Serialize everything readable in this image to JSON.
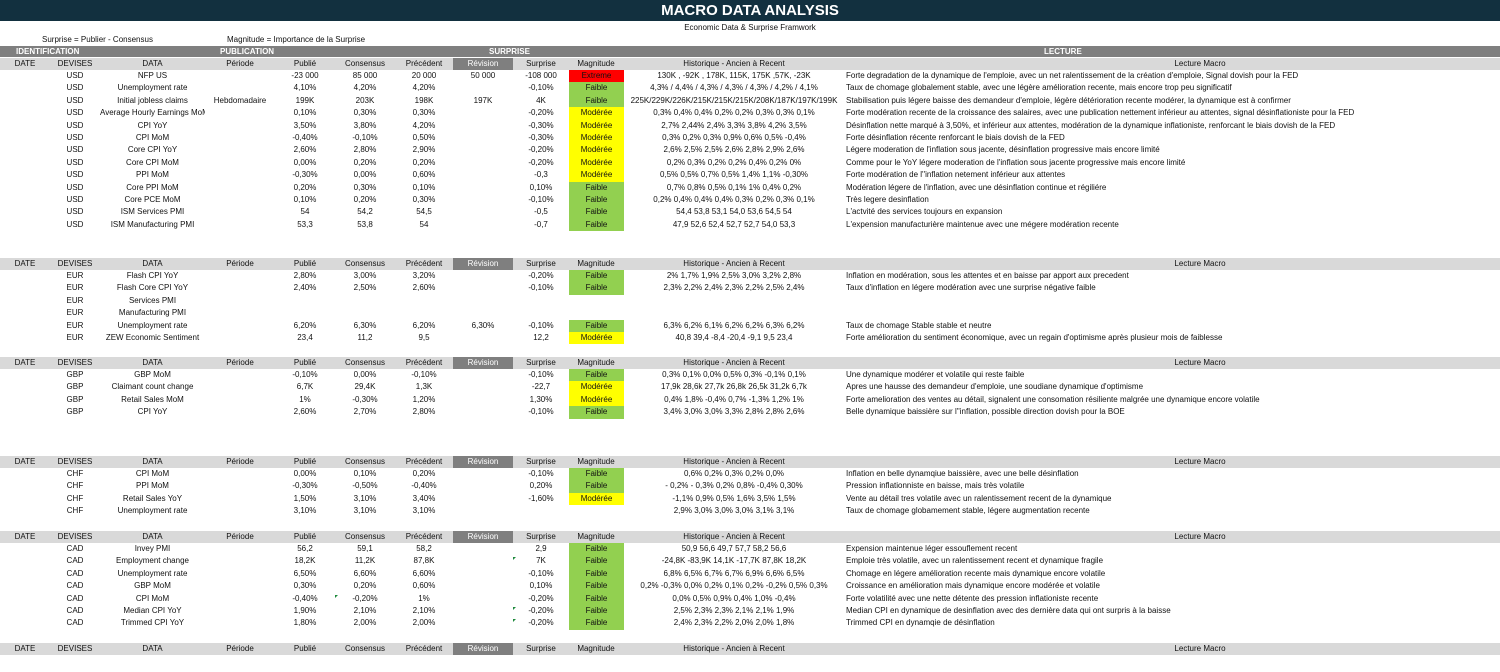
{
  "title": "MACRO DATA ANALYSIS",
  "subtitle": "Economic Data & Surprise Framwork",
  "legend": {
    "surprise": "Surprise = Publier - Consensus",
    "magnitude": "Magnitude = Importance de la Surprise"
  },
  "groups": {
    "identification": "IDENTIFICATION",
    "publication": "PUBLICATION",
    "surprise": "SURPRISE",
    "lecture": "LECTURE"
  },
  "headers": {
    "date": "DATE",
    "devises": "DEVISES",
    "data": "DATA",
    "periode": "Période",
    "publie": "Publié",
    "consensus": "Consensus",
    "precedent": "Précédent",
    "revision": "Révision",
    "surprise": "Surprise",
    "magnitude": "Magnitude",
    "historique": "Historique - Ancien à Recent",
    "lecture": "Lecture Macro"
  },
  "colors": {
    "title_bg": "#12303f",
    "faible": "#92d050",
    "moderee": "#ffff00",
    "extreme": "#ff0000"
  },
  "sections": [
    {
      "rows": [
        {
          "devise": "USD",
          "data": "NFP US",
          "periode": "",
          "publie": "-23 000",
          "consensus": "85 000",
          "precedent": "20 000",
          "revision": "50 000",
          "surprise": "-108 000",
          "magnitude": "Extreme",
          "historique": "130K , -92K , 178K, 115K, 175K ,57K, -23K",
          "lecture": "Forte degradation de la dynamique de l'emploie, avec un net ralentissement de la création d'emploie, Signal dovish pour la FED"
        },
        {
          "devise": "USD",
          "data": "Unemployment rate",
          "periode": "",
          "publie": "4,10%",
          "consensus": "4,20%",
          "precedent": "4,20%",
          "revision": "",
          "surprise": "-0,10%",
          "magnitude": "Faible",
          "historique": "4,3% / 4,4% / 4,3% / 4,3% / 4,3% / 4,2% / 4,1%",
          "lecture": "Taux de chomage globalement stable, avec une légère amélioration recente, mais encore trop peu significatif"
        },
        {
          "devise": "USD",
          "data": "Initial jobless claims",
          "periode": "Hebdomadaire",
          "publie": "199K",
          "consensus": "203K",
          "precedent": "198K",
          "revision": "197K",
          "surprise": "4K",
          "magnitude": "Faible",
          "historique": "225K/229K/226K/215K/215K/215K/208K/187K/197K/199K",
          "lecture": "Stabilisation puis légere baisse des demandeur d'emploie, légère détérioration recente modérer, la dynamique est à confirmer"
        },
        {
          "devise": "USD",
          "data": "Average Hourly Earnings MoM",
          "periode": "",
          "publie": "0,10%",
          "consensus": "0,30%",
          "precedent": "0,30%",
          "revision": "",
          "surprise": "-0,20%",
          "magnitude": "Modérée",
          "historique": "0,3% 0,4% 0,4% 0,2% 0,2% 0,3% 0,3% 0,1%",
          "lecture": "Forte modération recente de la croissance des salaires, avec une publication nettement inférieur au attentes, signal désinflationiste pour la FED"
        },
        {
          "devise": "USD",
          "data": "CPI YoY",
          "periode": "",
          "publie": "3,50%",
          "consensus": "3,80%",
          "precedent": "4,20%",
          "revision": "",
          "surprise": "-0,30%",
          "magnitude": "Modérée",
          "historique": "2,7% 2,44% 2,4% 3,3% 3,8% 4,2% 3,5%",
          "lecture": "Désinflation nette marqué à 3,50%, et inférieur aux attentes, modération de la dynamique inflationiste, renforcant le biais dovish de la FED"
        },
        {
          "devise": "USD",
          "data": "CPI MoM",
          "periode": "",
          "publie": "-0,40%",
          "consensus": "-0,10%",
          "precedent": "0,50%",
          "revision": "",
          "surprise": "-0,30%",
          "magnitude": "Modérée",
          "historique": "0,3% 0,2% 0,3% 0,9% 0,6% 0,5% -0,4%",
          "lecture": "Forte désinflation récente renforcant le biais dovish de la FED"
        },
        {
          "devise": "USD",
          "data": "Core CPI YoY",
          "periode": "",
          "publie": "2,60%",
          "consensus": "2,80%",
          "precedent": "2,90%",
          "revision": "",
          "surprise": "-0,20%",
          "magnitude": "Modérée",
          "historique": "2,6% 2,5% 2,5% 2,6% 2,8% 2,9% 2,6%",
          "lecture": "Légere moderation de l'inflation sous jacente, désinflation progressive mais encore limité"
        },
        {
          "devise": "USD",
          "data": "Core CPI MoM",
          "periode": "",
          "publie": "0,00%",
          "consensus": "0,20%",
          "precedent": "0,20%",
          "revision": "",
          "surprise": "-0,20%",
          "magnitude": "Modérée",
          "historique": "0,2% 0,3% 0,2% 0,2% 0,4% 0,2% 0%",
          "lecture": "Comme pour le YoY légere moderation de l'inflation sous jacente progressive mais encore limité"
        },
        {
          "devise": "USD",
          "data": "PPI MoM",
          "periode": "",
          "publie": "-0,30%",
          "consensus": "0,00%",
          "precedent": "0,60%",
          "revision": "",
          "surprise": "-0,3",
          "magnitude": "Modérée",
          "historique": "0,5% 0,5% 0,7% 0,5% 1,4% 1,1% -0,30%",
          "lecture": "Forte modération de l''inflation netement inférieur aux attentes"
        },
        {
          "devise": "USD",
          "data": "Core PPI MoM",
          "periode": "",
          "publie": "0,20%",
          "consensus": "0,30%",
          "precedent": "0,10%",
          "revision": "",
          "surprise": "0,10%",
          "magnitude": "Faible",
          "historique": "0,7% 0,8% 0,5% 0,1% 1% 0,4% 0,2%",
          "lecture": "Modération légere de l'inflation, avec une désinflation continue et régiliére"
        },
        {
          "devise": "USD",
          "data": "Core PCE MoM",
          "periode": "",
          "publie": "0,10%",
          "consensus": "0,20%",
          "precedent": "0,30%",
          "revision": "",
          "surprise": "-0,10%",
          "magnitude": "Faible",
          "historique": "0,2% 0,4% 0,4% 0,4% 0,3% 0,2% 0,3% 0,1%",
          "lecture": "Très legere desinflation"
        },
        {
          "devise": "USD",
          "data": "ISM Services PMI",
          "periode": "",
          "publie": "54",
          "consensus": "54,2",
          "precedent": "54,5",
          "revision": "",
          "surprise": "-0,5",
          "magnitude": "Faible",
          "historique": "54,4 53,8 53,1 54,0 53,6 54,5 54",
          "lecture": "L'actvité des services toujours en expansion"
        },
        {
          "devise": "USD",
          "data": "ISM Manufacturing PMI",
          "periode": "",
          "publie": "53,3",
          "consensus": "53,8",
          "precedent": "54",
          "revision": "",
          "surprise": "-0,7",
          "magnitude": "Faible",
          "historique": "47,9 52,6 52,4 52,7 52,7 54,0 53,3",
          "lecture": "L'expension manufacturière maintenue avec une mégere modération recente"
        }
      ]
    },
    {
      "rows": [
        {
          "devise": "EUR",
          "data": "Flash CPI YoY",
          "periode": "",
          "publie": "2,80%",
          "consensus": "3,00%",
          "precedent": "3,20%",
          "revision": "",
          "surprise": "-0,20%",
          "magnitude": "Faible",
          "historique": "2% 1,7% 1,9% 2,5% 3,0% 3,2% 2,8%",
          "lecture": "Inflation en modération, sous les attentes et en baisse par apport aux precedent"
        },
        {
          "devise": "EUR",
          "data": "Flash Core CPI YoY",
          "periode": "",
          "publie": "2,40%",
          "consensus": "2,50%",
          "precedent": "2,60%",
          "revision": "",
          "surprise": "-0,10%",
          "magnitude": "Faible",
          "historique": "2,3% 2,2% 2,4% 2,3% 2,2% 2,5% 2,4%",
          "lecture": "Taux d'inflation en légere modération avec une surprise négative faible"
        },
        {
          "devise": "EUR",
          "data": "Services PMI",
          "periode": "",
          "publie": "",
          "consensus": "",
          "precedent": "",
          "revision": "",
          "surprise": "",
          "magnitude": "",
          "historique": "",
          "lecture": ""
        },
        {
          "devise": "EUR",
          "data": "Manufacturing PMI",
          "periode": "",
          "publie": "",
          "consensus": "",
          "precedent": "",
          "revision": "",
          "surprise": "",
          "magnitude": "",
          "historique": "",
          "lecture": ""
        },
        {
          "devise": "EUR",
          "data": "Unemployment rate",
          "periode": "",
          "publie": "6,20%",
          "consensus": "6,30%",
          "precedent": "6,20%",
          "revision": "6,30%",
          "surprise": "-0,10%",
          "magnitude": "Faible",
          "historique": "6,3% 6,2% 6,1% 6,2% 6,2% 6,3% 6,2%",
          "lecture": "Taux de chomage Stable stable et neutre"
        },
        {
          "devise": "EUR",
          "data": "ZEW Economic Sentiment",
          "periode": "",
          "publie": "23,4",
          "consensus": "11,2",
          "precedent": "9,5",
          "revision": "",
          "surprise": "12,2",
          "magnitude": "Modérée",
          "historique": "40,8 39,4 -8,4 -20,4 -9,1 9,5 23,4",
          "lecture": "Forte amélioration du sentiment économique, avec un regain d'optimisme après plusieur mois de faiblesse"
        }
      ]
    },
    {
      "rows": [
        {
          "devise": "GBP",
          "data": "GBP MoM",
          "periode": "",
          "publie": "-0,10%",
          "consensus": "0,00%",
          "precedent": "-0,10%",
          "revision": "",
          "surprise": "-0,10%",
          "magnitude": "Faible",
          "historique": "0,3% 0,1% 0,0% 0,5% 0,3% -0,1% 0,1%",
          "lecture": "Une dynamique modérer et volatile qui reste faible"
        },
        {
          "devise": "GBP",
          "data": "Claimant count change",
          "periode": "",
          "publie": "6,7K",
          "consensus": "29,4K",
          "precedent": "1,3K",
          "revision": "",
          "surprise": "-22,7",
          "magnitude": "Modérée",
          "historique": "17,9k 28,6k 27,7k 26,8k 26,5k 31,2k 6,7k",
          "lecture": "Apres une hausse des demandeur d'emploie, une soudiane dynamique d'optimisme"
        },
        {
          "devise": "GBP",
          "data": "Retail Sales MoM",
          "periode": "",
          "publie": "1%",
          "consensus": "-0,30%",
          "precedent": "1,20%",
          "revision": "",
          "surprise": "1,30%",
          "magnitude": "Modérée",
          "historique": "0,4% 1,8% -0,4% 0,7% -1,3% 1,2% 1%",
          "lecture": "Forte amelioration des ventes au détail, signalent une consomation résiliente malgrée une dynamique encore volatile"
        },
        {
          "devise": "GBP",
          "data": "CPI YoY",
          "periode": "",
          "publie": "2,60%",
          "consensus": "2,70%",
          "precedent": "2,80%",
          "revision": "",
          "surprise": "-0,10%",
          "magnitude": "Faible",
          "historique": "3,4% 3,0% 3,0% 3,3% 2,8% 2,8% 2,6%",
          "lecture": "Belle dynamique baissière sur l''inflation, possible direction dovish pour la BOE"
        }
      ]
    },
    {
      "rows": [
        {
          "devise": "CHF",
          "data": "CPI MoM",
          "periode": "",
          "publie": "0,00%",
          "consensus": "0,10%",
          "precedent": "0,20%",
          "revision": "",
          "surprise": "-0,10%",
          "magnitude": "Faible",
          "historique": "0,6% 0,2% 0,3% 0,2% 0,0%",
          "lecture": "Inflation en belle dynamqiue baissière, avec une belle désinflation"
        },
        {
          "devise": "CHF",
          "data": "PPI MoM",
          "periode": "",
          "publie": "-0,30%",
          "consensus": "-0,50%",
          "precedent": "-0,40%",
          "revision": "",
          "surprise": "0,20%",
          "magnitude": "Faible",
          "historique": "- 0,2% - 0,3% 0,2% 0,8% -0,4% 0,30%",
          "lecture": "Pression inflationniste en baisse, mais très volatile"
        },
        {
          "devise": "CHF",
          "data": "Retail Sales YoY",
          "periode": "",
          "publie": "1,50%",
          "consensus": "3,10%",
          "precedent": "3,40%",
          "revision": "",
          "surprise": "-1,60%",
          "magnitude": "Modérée",
          "historique": "-1,1% 0,9% 0,5% 1,6% 3,5% 1,5%",
          "lecture": "Vente au détail tres volatile avec un ralentissement recent de la dynamique"
        },
        {
          "devise": "CHF",
          "data": "Unemployment rate",
          "periode": "",
          "publie": "3,10%",
          "consensus": "3,10%",
          "precedent": "3,10%",
          "revision": "",
          "surprise": "",
          "magnitude": "",
          "historique": "2,9% 3,0% 3,0% 3,0% 3,1% 3,1%",
          "lecture": "Taux de chomage globamement stable, légere augmentation recente"
        }
      ]
    },
    {
      "rows": [
        {
          "devise": "CAD",
          "data": "Invey PMI",
          "periode": "",
          "publie": "56,2",
          "consensus": "59,1",
          "precedent": "58,2",
          "revision": "",
          "surprise": "2,9",
          "magnitude": "Faible",
          "historique": "50,9 56,6 49,7 57,7 58,2 56,6",
          "lecture": "Expension maintenue léger essouflement recent"
        },
        {
          "devise": "CAD",
          "data": "Employment change",
          "periode": "",
          "publie": "18,2K",
          "consensus": "11,2K",
          "precedent": "87,8K",
          "revision": "",
          "surprise": "7K",
          "magnitude": "Faible",
          "historique": "-24,8K -83,9K 14,1K -17,7K 87,8K 18,2K",
          "lecture": "Emploie très volatile, avec un ralentissement recent et dynamique fragile"
        },
        {
          "devise": "CAD",
          "data": "Unemployment rate",
          "periode": "",
          "publie": "6,50%",
          "consensus": "6,60%",
          "precedent": "6,60%",
          "revision": "",
          "surprise": "-0,10%",
          "magnitude": "Faible",
          "historique": "6,8% 6,5% 6,7% 6,7% 6,9% 6,6% 6,5%",
          "lecture": "Chomage en légere amélioration recente mais dynamique encore volatile"
        },
        {
          "devise": "CAD",
          "data": "GBP MoM",
          "periode": "",
          "publie": "0,30%",
          "consensus": "0,20%",
          "precedent": "0,60%",
          "revision": "",
          "surprise": "0,10%",
          "magnitude": "Faible",
          "historique": "0,2% -0,3% 0,0% 0,2% 0,1% 0,2% -0,2% 0,5% 0,3%",
          "lecture": "Croissance en amélioration mais dynamique encore modérée et volatile"
        },
        {
          "devise": "CAD",
          "data": "CPI MoM",
          "periode": "",
          "publie": "-0,40%",
          "consensus": "-0,20%",
          "precedent": "1%",
          "revision": "",
          "surprise": "-0,20%",
          "magnitude": "Faible",
          "historique": "0,0% 0,5% 0,9% 0,4% 1,0% -0,4%",
          "lecture": "Forte volatilité avec une nette détente des pression inflationiste recente"
        },
        {
          "devise": "CAD",
          "data": "Median CPI YoY",
          "periode": "",
          "publie": "1,90%",
          "consensus": "2,10%",
          "precedent": "2,10%",
          "revision": "",
          "surprise": "-0,20%",
          "magnitude": "Faible",
          "historique": "2,5% 2,3% 2,3% 2,1% 2,1% 1,9%",
          "lecture": "Median CPI en dynamique de desinflation avec des dernière data qui ont surpris à la baisse"
        },
        {
          "devise": "CAD",
          "data": "Trimmed CPI YoY",
          "periode": "",
          "publie": "1,80%",
          "consensus": "2,00%",
          "precedent": "2,00%",
          "revision": "",
          "surprise": "-0,20%",
          "magnitude": "Faible",
          "historique": "2,4% 2,3% 2,2% 2,0% 2,0% 1,8%",
          "lecture": "Trimmed CPI en dynamqie de désinflation"
        }
      ]
    },
    {
      "rows": []
    }
  ]
}
